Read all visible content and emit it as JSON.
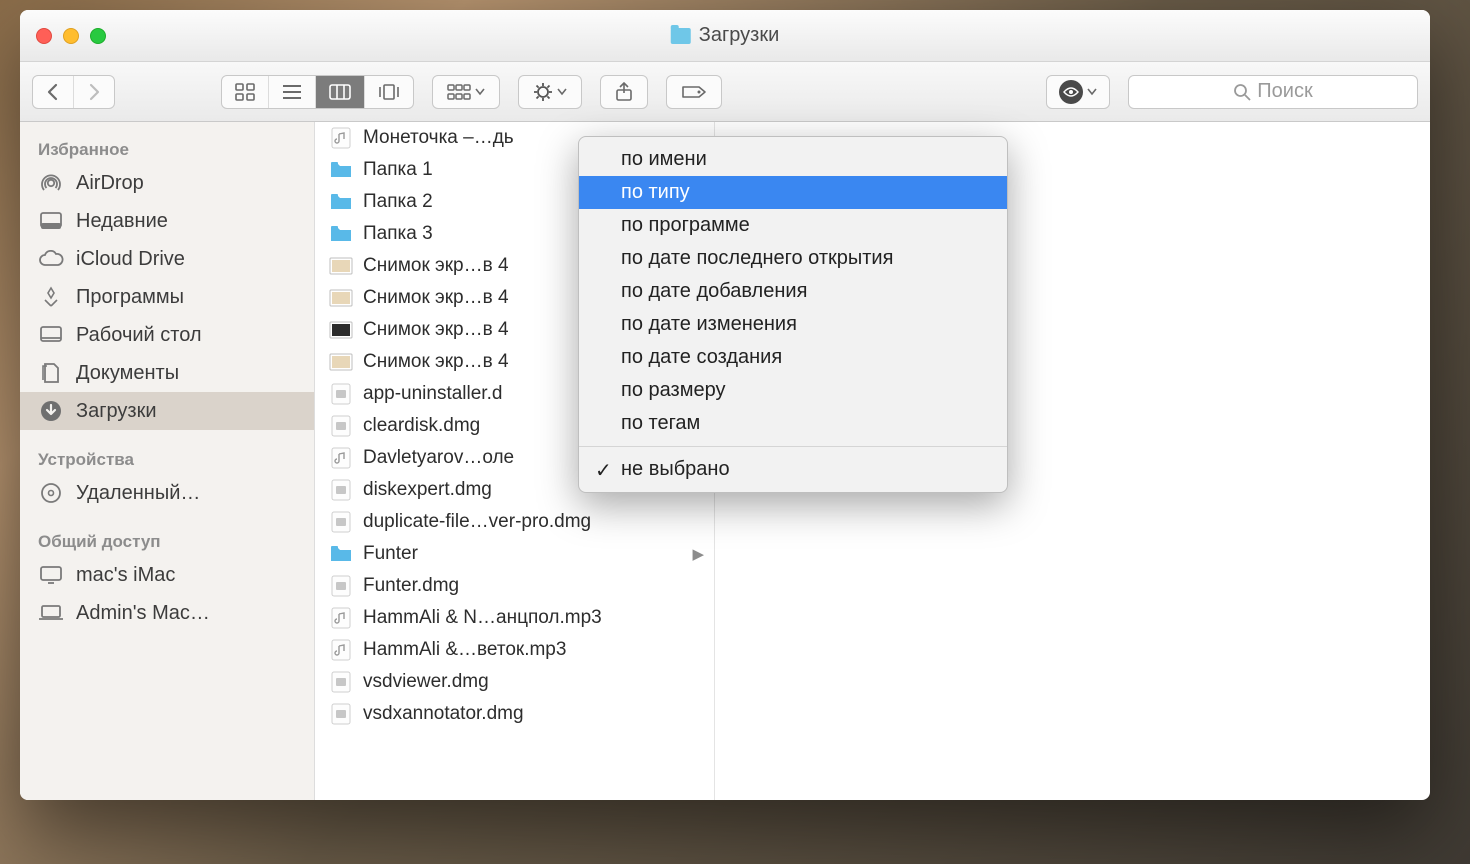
{
  "window": {
    "title": "Загрузки"
  },
  "search": {
    "placeholder": "Поиск"
  },
  "sidebar": {
    "sections": [
      {
        "header": "Избранное",
        "items": [
          {
            "label": "AirDrop",
            "icon": "airdrop"
          },
          {
            "label": "Недавние",
            "icon": "recents"
          },
          {
            "label": "iCloud Drive",
            "icon": "cloud"
          },
          {
            "label": "Программы",
            "icon": "apps"
          },
          {
            "label": "Рабочий стол",
            "icon": "desktop"
          },
          {
            "label": "Документы",
            "icon": "documents"
          },
          {
            "label": "Загрузки",
            "icon": "downloads",
            "selected": true
          }
        ]
      },
      {
        "header": "Устройства",
        "items": [
          {
            "label": "Удаленный…",
            "icon": "disc"
          }
        ]
      },
      {
        "header": "Общий доступ",
        "items": [
          {
            "label": "mac's iMac",
            "icon": "display"
          },
          {
            "label": "Admin's Mac…",
            "icon": "laptop"
          }
        ]
      }
    ]
  },
  "files": [
    {
      "label": "Монеточка –…дь",
      "icon": "audio"
    },
    {
      "label": "Папка 1",
      "icon": "folder"
    },
    {
      "label": "Папка 2",
      "icon": "folder"
    },
    {
      "label": "Папка 3",
      "icon": "folder"
    },
    {
      "label": "Снимок экр…в 4",
      "icon": "image"
    },
    {
      "label": "Снимок экр…в 4",
      "icon": "image"
    },
    {
      "label": "Снимок экр…в 4",
      "icon": "image-dark"
    },
    {
      "label": "Снимок экр…в 4",
      "icon": "image"
    },
    {
      "label": "app-uninstaller.d",
      "icon": "dmg"
    },
    {
      "label": "cleardisk.dmg",
      "icon": "dmg"
    },
    {
      "label": "Davletyarov…оле",
      "icon": "audio"
    },
    {
      "label": "diskexpert.dmg",
      "icon": "dmg"
    },
    {
      "label": "duplicate-file…ver-pro.dmg",
      "icon": "dmg"
    },
    {
      "label": "Funter",
      "icon": "folder",
      "hasArrow": true
    },
    {
      "label": "Funter.dmg",
      "icon": "dmg"
    },
    {
      "label": "HammAli & N…анцпол.mp3",
      "icon": "audio"
    },
    {
      "label": "HammAli &…веток.mp3",
      "icon": "audio"
    },
    {
      "label": "vsdviewer.dmg",
      "icon": "dmg"
    },
    {
      "label": "vsdxannotator.dmg",
      "icon": "dmg"
    }
  ],
  "menu": {
    "items": [
      {
        "label": "по имени"
      },
      {
        "label": "по типу",
        "highlight": true
      },
      {
        "label": "по программе"
      },
      {
        "label": "по дате последнего открытия"
      },
      {
        "label": "по дате добавления"
      },
      {
        "label": "по дате изменения"
      },
      {
        "label": "по дате создания"
      },
      {
        "label": "по размеру"
      },
      {
        "label": "по тегам"
      }
    ],
    "footer": {
      "label": "не выбрано",
      "checked": true
    }
  }
}
